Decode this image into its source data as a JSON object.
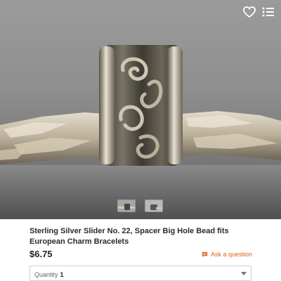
{
  "product": {
    "title": "Sterling Silver Slider No. 22, Spacer Big Hole Bead fits European Charm Bracelets",
    "price": "$6.75"
  },
  "actions": {
    "ask_question_label": "Ask a question",
    "ask_icon": "chat-bubble-icon",
    "favorite_icon": "heart-icon",
    "menu_icon": "list-menu-icon"
  },
  "quantity": {
    "label": "Quantity",
    "selected": "1"
  },
  "gallery": {
    "image_count": 2,
    "active_index": 0
  },
  "colors": {
    "accent": "#d9621c",
    "price": "#222222",
    "background_photo": "#8f8f8f"
  }
}
